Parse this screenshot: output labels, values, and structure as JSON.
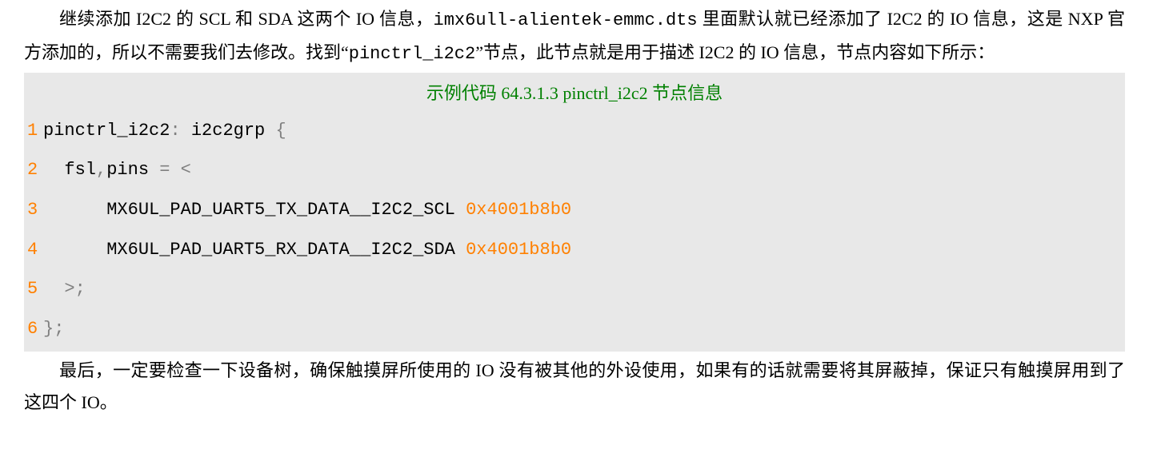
{
  "para1_prefix": "继续添加 I2C2 的 SCL 和 SDA 这两个 IO 信息，",
  "para1_mono1": "imx6ull-alientek-emmc.dts",
  "para1_mid1": " 里面默认就已经添加了 I2C2 的 IO 信息，这是 NXP 官方添加的，所以不需要我们去修改。找到",
  "para1_quote_open": "“",
  "para1_mono2": "pinctrl_i2c2",
  "para1_quote_close": "”",
  "para1_end": "节点，此节点就是用于描述 I2C2 的 IO 信息，节点内容如下所示：",
  "code_title": "示例代码 64.3.1.3 pinctrl_i2c2 节点信息",
  "lines": [
    {
      "num": "1",
      "seg1": "pinctrl_i2c2",
      "op1": ":",
      "seg2": " i2c2grp ",
      "op2": "{"
    },
    {
      "num": "2",
      "seg1": "  fsl",
      "op1": ",",
      "seg2": "pins ",
      "op2": "=",
      "seg3": " ",
      "op3": "<"
    },
    {
      "num": "3",
      "seg1": "      MX6UL_PAD_UART5_TX_DATA__I2C2_SCL ",
      "hex": "0x4001b8b0"
    },
    {
      "num": "4",
      "seg1": "      MX6UL_PAD_UART5_RX_DATA__I2C2_SDA ",
      "hex": "0x4001b8b0"
    },
    {
      "num": "5",
      "seg1": "  ",
      "op1": ">;"
    },
    {
      "num": "6",
      "op1": "};"
    }
  ],
  "para2": "最后，一定要检查一下设备树，确保触摸屏所使用的 IO 没有被其他的外设使用，如果有的话就需要将其屏蔽掉，保证只有触摸屏用到了这四个 IO。"
}
